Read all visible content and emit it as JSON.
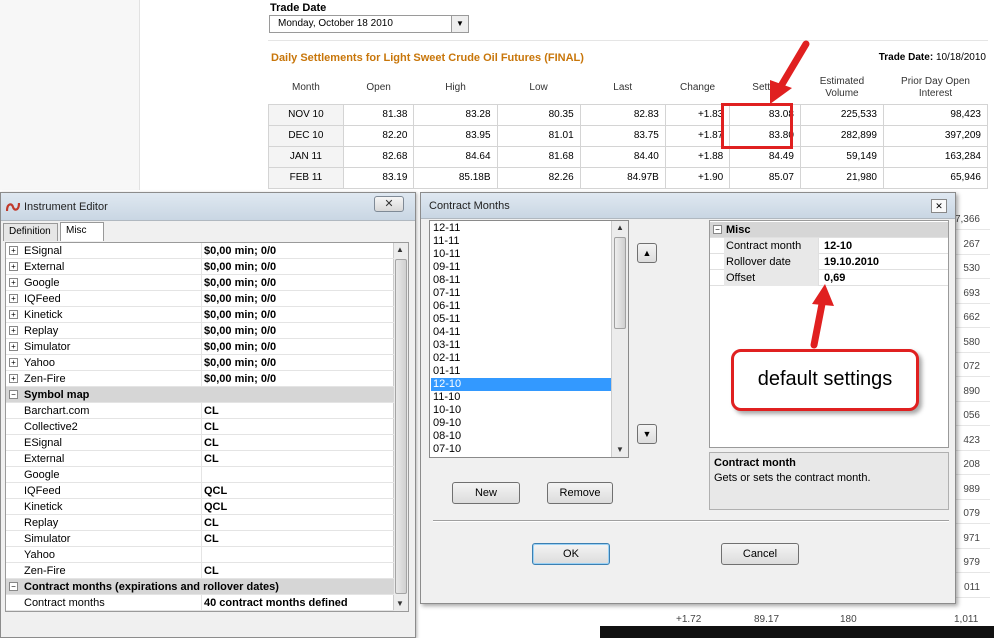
{
  "web": {
    "trade_date_label": "Trade Date",
    "trade_date_value": "Monday, October 18 2010",
    "settlements_title": "Daily Settlements for Light Sweet Crude Oil Futures (FINAL)",
    "trade_date_right_label": "Trade Date:",
    "trade_date_right_value": "10/18/2010",
    "columns": [
      "Month",
      "Open",
      "High",
      "Low",
      "Last",
      "Change",
      "Settle",
      "Estimated Volume",
      "Prior Day Open Interest"
    ],
    "rows": [
      [
        "NOV 10",
        "81.38",
        "83.28",
        "80.35",
        "82.83",
        "+1.83",
        "83.08",
        "225,533",
        "98,423"
      ],
      [
        "DEC 10",
        "82.20",
        "83.95",
        "81.01",
        "83.75",
        "+1.87",
        "83.80",
        "282,899",
        "397,209"
      ],
      [
        "JAN 11",
        "82.68",
        "84.64",
        "81.68",
        "84.40",
        "+1.88",
        "84.49",
        "59,149",
        "163,284"
      ],
      [
        "FEB 11",
        "83.19",
        "85.18B",
        "82.26",
        "84.97B",
        "+1.90",
        "85.07",
        "21,980",
        "65,946"
      ]
    ],
    "right_column_partial": [
      "7,366",
      "267",
      "530",
      "693",
      "662",
      "580",
      "072",
      "890",
      "056",
      "423",
      "208",
      "989",
      "079",
      "971",
      "979",
      "011"
    ],
    "bottom_partial": {
      "change": "+1.72",
      "settle": "89.17",
      "volume": "180",
      "oi": "1,011"
    }
  },
  "instrument_editor": {
    "title": "Instrument Editor",
    "tabs": [
      "Definition",
      "Misc"
    ],
    "active_tab": "Misc",
    "rows": [
      {
        "type": "item",
        "expand": true,
        "name": "ESignal",
        "value": "$0,00 min;  0/0"
      },
      {
        "type": "item",
        "expand": true,
        "name": "External",
        "value": "$0,00 min;  0/0"
      },
      {
        "type": "item",
        "expand": true,
        "name": "Google",
        "value": "$0,00 min;  0/0"
      },
      {
        "type": "item",
        "expand": true,
        "name": "IQFeed",
        "value": "$0,00 min;  0/0"
      },
      {
        "type": "item",
        "expand": true,
        "name": "Kinetick",
        "value": "$0,00 min;  0/0"
      },
      {
        "type": "item",
        "expand": true,
        "name": "Replay",
        "value": "$0,00 min;  0/0"
      },
      {
        "type": "item",
        "expand": true,
        "name": "Simulator",
        "value": "$0,00 min;  0/0"
      },
      {
        "type": "item",
        "expand": true,
        "name": "Yahoo",
        "value": "$0,00 min;  0/0"
      },
      {
        "type": "item",
        "expand": true,
        "name": "Zen-Fire",
        "value": "$0,00 min;  0/0"
      },
      {
        "type": "category",
        "name": "Symbol map"
      },
      {
        "type": "item",
        "expand": false,
        "name": "Barchart.com",
        "value": "CL"
      },
      {
        "type": "item",
        "expand": false,
        "name": "Collective2",
        "value": "CL"
      },
      {
        "type": "item",
        "expand": false,
        "name": "ESignal",
        "value": "CL"
      },
      {
        "type": "item",
        "expand": false,
        "name": "External",
        "value": "CL"
      },
      {
        "type": "item",
        "expand": false,
        "name": "Google",
        "value": ""
      },
      {
        "type": "item",
        "expand": false,
        "name": "IQFeed",
        "value": "QCL"
      },
      {
        "type": "item",
        "expand": false,
        "name": "Kinetick",
        "value": "QCL"
      },
      {
        "type": "item",
        "expand": false,
        "name": "Replay",
        "value": "CL"
      },
      {
        "type": "item",
        "expand": false,
        "name": "Simulator",
        "value": "CL"
      },
      {
        "type": "item",
        "expand": false,
        "name": "Yahoo",
        "value": ""
      },
      {
        "type": "item",
        "expand": false,
        "name": "Zen-Fire",
        "value": "CL"
      },
      {
        "type": "category",
        "name": "Contract months (expirations and rollover dates)"
      },
      {
        "type": "item",
        "expand": false,
        "name": "Contract months",
        "value": "40 contract months defined"
      }
    ]
  },
  "contract_months": {
    "title": "Contract Months",
    "list": [
      "12-11",
      "11-11",
      "10-11",
      "09-11",
      "08-11",
      "07-11",
      "06-11",
      "05-11",
      "04-11",
      "03-11",
      "02-11",
      "01-11",
      "12-10",
      "11-10",
      "10-10",
      "09-10",
      "08-10",
      "07-10"
    ],
    "selected": "12-10",
    "buttons": {
      "new": "New",
      "remove": "Remove",
      "ok": "OK",
      "cancel": "Cancel"
    },
    "props": {
      "category": "Misc",
      "contract_month_label": "Contract month",
      "contract_month_value": "12-10",
      "rollover_label": "Rollover date",
      "rollover_value": "19.10.2010",
      "offset_label": "Offset",
      "offset_value": "0,69"
    },
    "description": {
      "heading": "Contract month",
      "text": "Gets or sets the contract month."
    }
  },
  "annotation": {
    "callout": "default settings",
    "color": "#e02020"
  }
}
